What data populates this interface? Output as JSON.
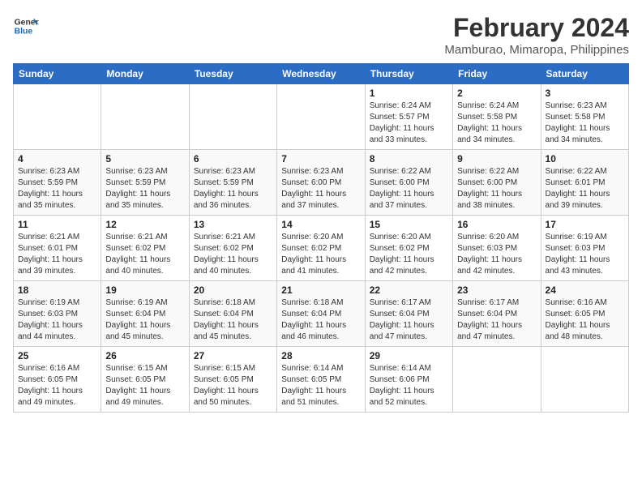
{
  "header": {
    "logo_line1": "General",
    "logo_line2": "Blue",
    "month_year": "February 2024",
    "location": "Mamburao, Mimaropa, Philippines"
  },
  "weekdays": [
    "Sunday",
    "Monday",
    "Tuesday",
    "Wednesday",
    "Thursday",
    "Friday",
    "Saturday"
  ],
  "weeks": [
    [
      {
        "day": "",
        "info": ""
      },
      {
        "day": "",
        "info": ""
      },
      {
        "day": "",
        "info": ""
      },
      {
        "day": "",
        "info": ""
      },
      {
        "day": "1",
        "info": "Sunrise: 6:24 AM\nSunset: 5:57 PM\nDaylight: 11 hours\nand 33 minutes."
      },
      {
        "day": "2",
        "info": "Sunrise: 6:24 AM\nSunset: 5:58 PM\nDaylight: 11 hours\nand 34 minutes."
      },
      {
        "day": "3",
        "info": "Sunrise: 6:23 AM\nSunset: 5:58 PM\nDaylight: 11 hours\nand 34 minutes."
      }
    ],
    [
      {
        "day": "4",
        "info": "Sunrise: 6:23 AM\nSunset: 5:59 PM\nDaylight: 11 hours\nand 35 minutes."
      },
      {
        "day": "5",
        "info": "Sunrise: 6:23 AM\nSunset: 5:59 PM\nDaylight: 11 hours\nand 35 minutes."
      },
      {
        "day": "6",
        "info": "Sunrise: 6:23 AM\nSunset: 5:59 PM\nDaylight: 11 hours\nand 36 minutes."
      },
      {
        "day": "7",
        "info": "Sunrise: 6:23 AM\nSunset: 6:00 PM\nDaylight: 11 hours\nand 37 minutes."
      },
      {
        "day": "8",
        "info": "Sunrise: 6:22 AM\nSunset: 6:00 PM\nDaylight: 11 hours\nand 37 minutes."
      },
      {
        "day": "9",
        "info": "Sunrise: 6:22 AM\nSunset: 6:00 PM\nDaylight: 11 hours\nand 38 minutes."
      },
      {
        "day": "10",
        "info": "Sunrise: 6:22 AM\nSunset: 6:01 PM\nDaylight: 11 hours\nand 39 minutes."
      }
    ],
    [
      {
        "day": "11",
        "info": "Sunrise: 6:21 AM\nSunset: 6:01 PM\nDaylight: 11 hours\nand 39 minutes."
      },
      {
        "day": "12",
        "info": "Sunrise: 6:21 AM\nSunset: 6:02 PM\nDaylight: 11 hours\nand 40 minutes."
      },
      {
        "day": "13",
        "info": "Sunrise: 6:21 AM\nSunset: 6:02 PM\nDaylight: 11 hours\nand 40 minutes."
      },
      {
        "day": "14",
        "info": "Sunrise: 6:20 AM\nSunset: 6:02 PM\nDaylight: 11 hours\nand 41 minutes."
      },
      {
        "day": "15",
        "info": "Sunrise: 6:20 AM\nSunset: 6:02 PM\nDaylight: 11 hours\nand 42 minutes."
      },
      {
        "day": "16",
        "info": "Sunrise: 6:20 AM\nSunset: 6:03 PM\nDaylight: 11 hours\nand 42 minutes."
      },
      {
        "day": "17",
        "info": "Sunrise: 6:19 AM\nSunset: 6:03 PM\nDaylight: 11 hours\nand 43 minutes."
      }
    ],
    [
      {
        "day": "18",
        "info": "Sunrise: 6:19 AM\nSunset: 6:03 PM\nDaylight: 11 hours\nand 44 minutes."
      },
      {
        "day": "19",
        "info": "Sunrise: 6:19 AM\nSunset: 6:04 PM\nDaylight: 11 hours\nand 45 minutes."
      },
      {
        "day": "20",
        "info": "Sunrise: 6:18 AM\nSunset: 6:04 PM\nDaylight: 11 hours\nand 45 minutes."
      },
      {
        "day": "21",
        "info": "Sunrise: 6:18 AM\nSunset: 6:04 PM\nDaylight: 11 hours\nand 46 minutes."
      },
      {
        "day": "22",
        "info": "Sunrise: 6:17 AM\nSunset: 6:04 PM\nDaylight: 11 hours\nand 47 minutes."
      },
      {
        "day": "23",
        "info": "Sunrise: 6:17 AM\nSunset: 6:04 PM\nDaylight: 11 hours\nand 47 minutes."
      },
      {
        "day": "24",
        "info": "Sunrise: 6:16 AM\nSunset: 6:05 PM\nDaylight: 11 hours\nand 48 minutes."
      }
    ],
    [
      {
        "day": "25",
        "info": "Sunrise: 6:16 AM\nSunset: 6:05 PM\nDaylight: 11 hours\nand 49 minutes."
      },
      {
        "day": "26",
        "info": "Sunrise: 6:15 AM\nSunset: 6:05 PM\nDaylight: 11 hours\nand 49 minutes."
      },
      {
        "day": "27",
        "info": "Sunrise: 6:15 AM\nSunset: 6:05 PM\nDaylight: 11 hours\nand 50 minutes."
      },
      {
        "day": "28",
        "info": "Sunrise: 6:14 AM\nSunset: 6:05 PM\nDaylight: 11 hours\nand 51 minutes."
      },
      {
        "day": "29",
        "info": "Sunrise: 6:14 AM\nSunset: 6:06 PM\nDaylight: 11 hours\nand 52 minutes."
      },
      {
        "day": "",
        "info": ""
      },
      {
        "day": "",
        "info": ""
      }
    ]
  ]
}
